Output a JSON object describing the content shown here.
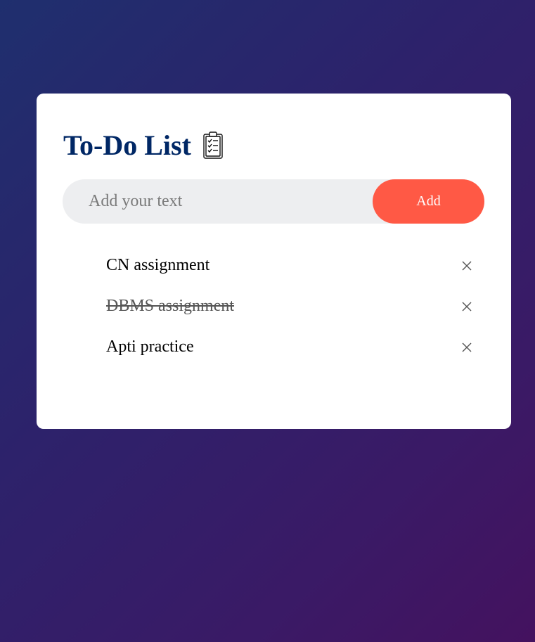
{
  "app": {
    "title": "To-Do List",
    "title_icon": "clipboard-checklist-icon"
  },
  "input": {
    "value": "",
    "placeholder": "Add your text",
    "add_label": "Add"
  },
  "colors": {
    "title": "#002765",
    "accent": "#ff5945",
    "input_background": "#edeef0",
    "background_gradient": [
      "#1f2f6e",
      "#44125f"
    ]
  },
  "tasks": [
    {
      "text": "CN assignment",
      "checked": false,
      "remove_icon": "close-icon"
    },
    {
      "text": "DBMS assignment",
      "checked": true,
      "remove_icon": "close-icon"
    },
    {
      "text": "Apti practice",
      "checked": false,
      "remove_icon": "close-icon"
    }
  ]
}
